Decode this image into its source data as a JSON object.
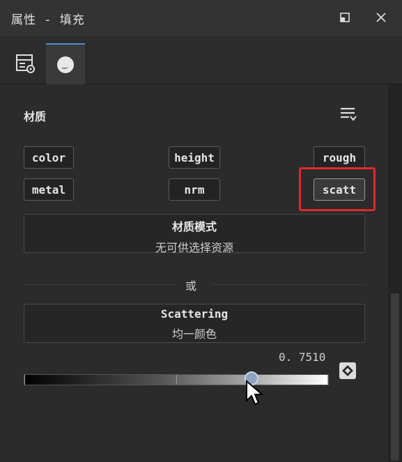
{
  "window": {
    "title": "属性 - 填充"
  },
  "tabs": [
    {
      "icon": "texture-settings-icon",
      "active": false
    },
    {
      "icon": "material-sphere-icon",
      "active": true
    }
  ],
  "section": {
    "title": "材质"
  },
  "channels": [
    "color",
    "height",
    "rough",
    "metal",
    "nrm",
    "scatt"
  ],
  "selected_channel": "scatt",
  "highlight_color": "#e3282b",
  "material_mode": {
    "label": "材质模式",
    "value": "无可供选择资源"
  },
  "or_text": "或",
  "scattering": {
    "label": "Scattering",
    "value": "均一颜色"
  },
  "slider": {
    "value_text": "0. 7510",
    "value": 0.751
  },
  "accent_color": "#4b8fd6"
}
